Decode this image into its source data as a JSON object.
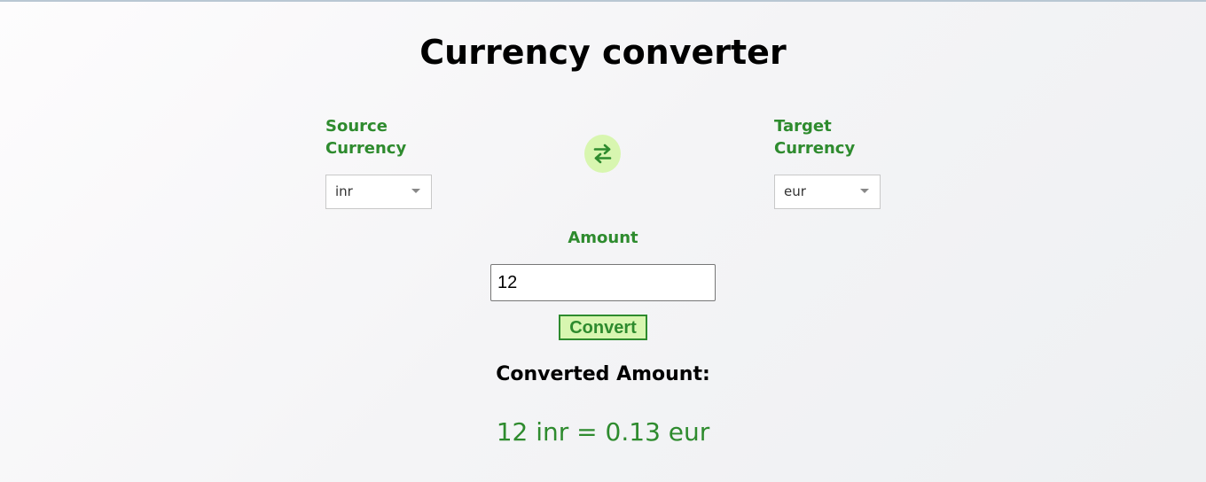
{
  "page": {
    "title": "Currency converter"
  },
  "source": {
    "label_line1": "Source",
    "label_line2": "Currency",
    "selected": "inr"
  },
  "target": {
    "label_line1": "Target",
    "label_line2": "Currency",
    "selected": "eur"
  },
  "swap": {
    "icon": "swap-arrows-icon"
  },
  "amount": {
    "label": "Amount",
    "value": "12"
  },
  "convert_button": {
    "label": "Convert"
  },
  "result": {
    "label": "Converted Amount:",
    "text": "12 inr = 0.13 eur"
  },
  "colors": {
    "accent_green": "#2e8b2e",
    "light_green": "#d8f6b0"
  }
}
